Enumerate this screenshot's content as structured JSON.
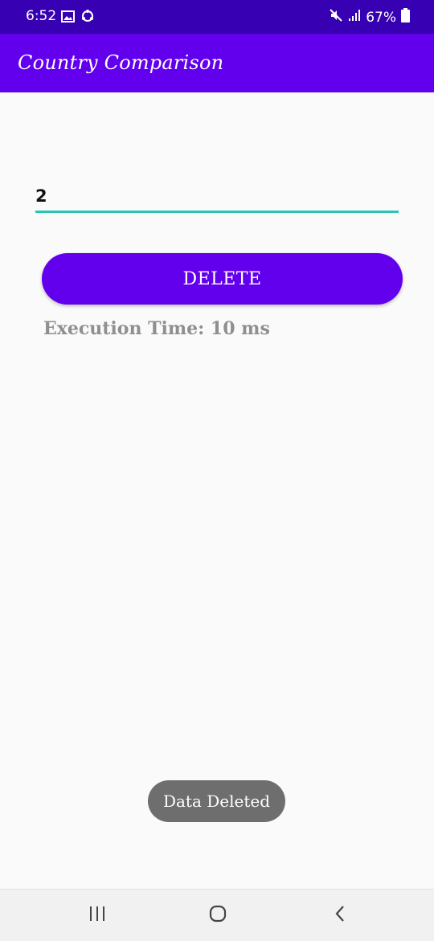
{
  "status_bar": {
    "time": "6:52",
    "battery": "67%",
    "icons": [
      "image-icon",
      "sync-icon",
      "mute-icon",
      "signal-icon",
      "battery-icon"
    ]
  },
  "app_bar": {
    "title": "Country Comparison"
  },
  "form": {
    "input_value": "2",
    "button_label": "DELETE",
    "execution_time": "Execution Time: 10 ms"
  },
  "toast": {
    "message": "Data Deleted"
  },
  "nav_bar": {
    "icons": [
      "recents-icon",
      "home-icon",
      "back-icon"
    ]
  },
  "colors": {
    "status_bar": "#3700b3",
    "primary": "#6200ee",
    "input_underline": "#26c6b2",
    "toast": "#6e6e6e"
  }
}
